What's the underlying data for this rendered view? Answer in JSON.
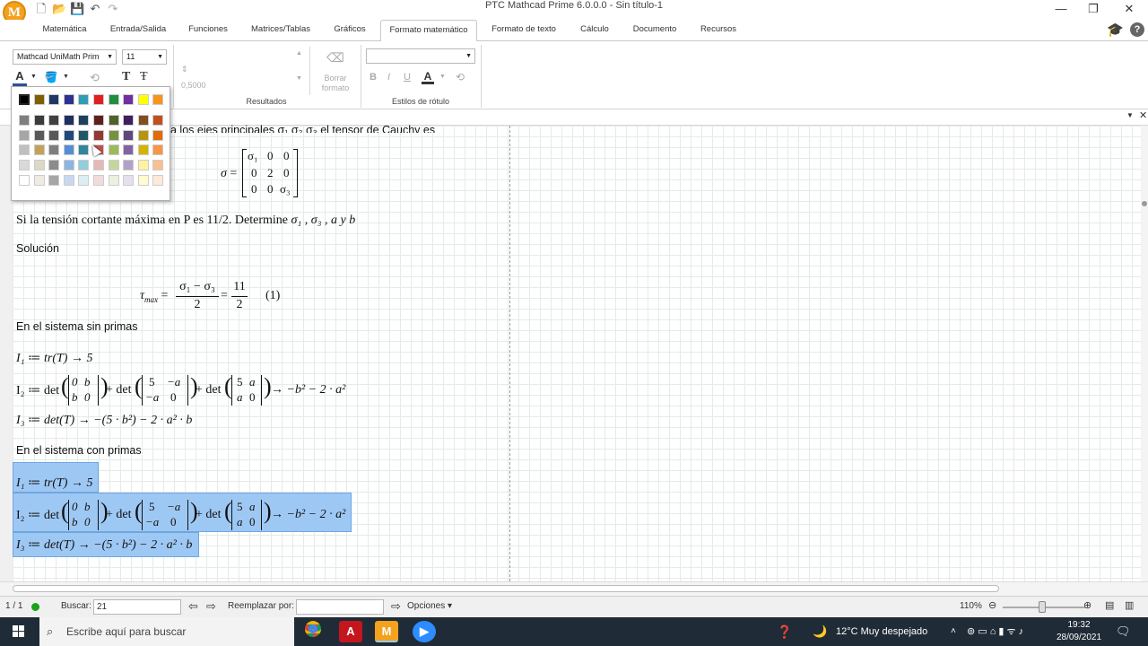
{
  "app": {
    "logo_letter": "M",
    "window_title": "PTC Mathcad Prime 6.0.0.0 - Sin título-1"
  },
  "tabs": [
    {
      "label": "Matemática"
    },
    {
      "label": "Entrada/Salida"
    },
    {
      "label": "Funciones"
    },
    {
      "label": "Matrices/Tablas"
    },
    {
      "label": "Gráficos"
    },
    {
      "label": "Formato matemático",
      "active": true
    },
    {
      "label": "Formato de texto"
    },
    {
      "label": "Cálculo"
    },
    {
      "label": "Documento"
    },
    {
      "label": "Recursos"
    }
  ],
  "ribbon": {
    "font_name": "Mathcad UniMath Prim",
    "font_size": "11",
    "results_value": "0,5000",
    "clear_format": "Borrar formato",
    "results_label": "Resultados",
    "label_styles": "Estilos de rótulo",
    "text_color_accent": "#2f5597"
  },
  "palette": {
    "selected_color": "#000000",
    "rows": [
      [
        "#000000",
        "#7f6000",
        "#203864",
        "#2e3192",
        "#2e9db5",
        "#e02020",
        "#1f8f3f",
        "#7030a0",
        "#ffff00",
        "#f79420"
      ],
      [
        "#7f7f7f",
        "#3b3b3b",
        "#404040",
        "#1f2f5f",
        "#1f3f5f",
        "#5f1f1f",
        "#4f6228",
        "#3f1f5f",
        "#7f4f1f",
        "#c05020"
      ],
      [
        "#a6a6a6",
        "#595959",
        "#595959",
        "#1f497d",
        "#215868",
        "#953735",
        "#76923c",
        "#5f497a",
        "#b7950b",
        "#e26b0a"
      ],
      [
        "#bfbfbf",
        "#c4a15a",
        "#7f7f7f",
        "#558ed5",
        "#31859c",
        "#c0504d",
        "#9bbb59",
        "#8064a2",
        "#d4b400",
        "#f79646"
      ],
      [
        "#d9d9d9",
        "#ddd9c4",
        "#8c8c8c",
        "#8db4e2",
        "#92cddc",
        "#e6b8b7",
        "#c4d79b",
        "#b3a2c7",
        "#fff2a0",
        "#fac090"
      ],
      [
        "#ffffff",
        "#eeece1",
        "#a6a6a6",
        "#c6d9f1",
        "#dbeef4",
        "#f2dcdb",
        "#ebf1de",
        "#e5e0ec",
        "#fffbd0",
        "#fde9d9"
      ]
    ]
  },
  "document": {
    "cut_top_text": "a los ejes principales σ₁ σ₂ σ₃ el tensor de Cauchy es",
    "sigma_lhs": "σ",
    "problem_text": "Si la tensión cortante máxima en P es 11/2. Determine",
    "problem_vars": "σ₁ , σ₃ , a y b",
    "solucion": "Solución",
    "sin_primas": "En el sistema sin primas",
    "con_primas": "En el sistema con primas",
    "eq_number": "(1)",
    "i1": "I₁ ≔ tr(T) → 5",
    "i2_lhs": "I₂ ≔ det",
    "i2_rhs": "→ −b² − 2 · a²",
    "i3": "I₃ ≔ det(T) → −(5 · b²) − 2 · a² · b",
    "sigma_matrix": [
      [
        "σ₁",
        "0",
        "0"
      ],
      [
        "0",
        "2",
        "0"
      ],
      [
        "0",
        "0",
        "σ₃"
      ]
    ],
    "m1": [
      [
        "0",
        "b"
      ],
      [
        "b",
        "0"
      ]
    ],
    "m2": [
      [
        "5",
        "−a"
      ],
      [
        "−a",
        "0"
      ]
    ],
    "m3": [
      [
        "5",
        "a"
      ],
      [
        "a",
        "0"
      ]
    ],
    "tau": "τ",
    "tau_sub": "max",
    "frac1_num": "σ₁ − σ₃",
    "frac_den": "2",
    "frac2_num": "11"
  },
  "status": {
    "page": "1 / 1",
    "buscar_label": "Buscar:",
    "buscar_value": "21",
    "reemplazar_label": "Reemplazar por:",
    "opciones": "Opciones",
    "zoom": "110%"
  },
  "taskbar": {
    "search_placeholder": "Escribe aquí para buscar",
    "weather": "12°C  Muy despejado",
    "time": "19:32",
    "date": "28/09/2021"
  }
}
